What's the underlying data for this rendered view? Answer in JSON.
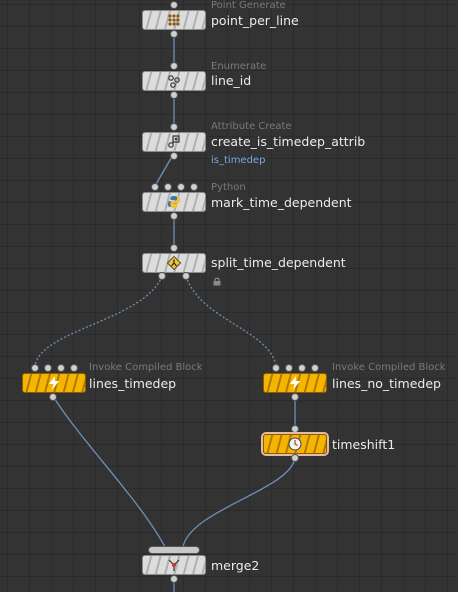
{
  "nodes": {
    "point_generate": {
      "type": "Point Generate",
      "name": "point_per_line"
    },
    "enumerate": {
      "type": "Enumerate",
      "name": "line_id"
    },
    "attribute_create": {
      "type": "Attribute Create",
      "name": "create_is_timedep_attrib",
      "sub": "is_timedep"
    },
    "python": {
      "type": "Python",
      "name": "mark_time_dependent"
    },
    "split": {
      "name": "split_time_dependent"
    },
    "invoke_left": {
      "type": "Invoke Compiled Block",
      "name": "lines_timedep"
    },
    "invoke_right": {
      "type": "Invoke Compiled Block",
      "name": "lines_no_timedep"
    },
    "timeshift": {
      "name": "timeshift1"
    },
    "merge": {
      "name": "merge2"
    }
  },
  "colors": {
    "background": "#333333",
    "grid": "#2b2b2b",
    "wire": "#6d90b8",
    "node_gray": "#dcdcdc",
    "node_yellow": "#f4b400",
    "subtitle_blue": "#79a9e6",
    "label": "#ececec",
    "type_label": "#7a7a7a"
  },
  "icons": {
    "point_generate": "dots-grid-icon",
    "enumerate": "enumerate-icon",
    "attribute_create": "attribute-create-icon",
    "python": "python-icon",
    "split": "split-diamond-icon",
    "invoke": "lightning-icon",
    "timeshift": "clock-icon",
    "merge": "merge-icon",
    "lock": "lock-icon"
  }
}
